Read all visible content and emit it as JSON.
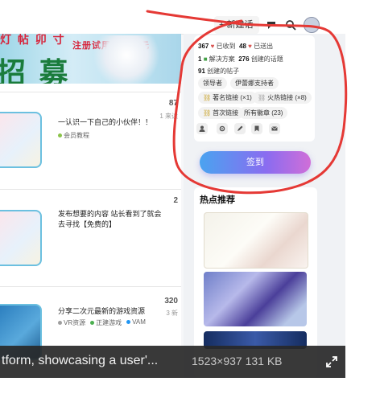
{
  "header": {
    "new_topic_label": "+ 新建话题",
    "icons": [
      "chat-icon",
      "search-icon",
      "avatar"
    ]
  },
  "banner": {
    "big_text": "招 募",
    "slogan": "注册试用仅需一元",
    "corner_text": "灯 帖 卯 寸"
  },
  "topics": [
    {
      "title": "一认识一下自己的小伙伴！！",
      "tags": [
        "会员教程"
      ],
      "tag_colors": [
        "#8bc34a"
      ],
      "count": "87",
      "count_sub": "1 来读"
    },
    {
      "title": "发布想要的内容 站长看到了就会 去寻找【免费的】",
      "tags": [],
      "tag_colors": [],
      "count": "2",
      "count_sub": ""
    },
    {
      "title": "分享二次元最新的游戏资源",
      "tags": [
        "VR资源",
        "正建游戏",
        "VAM"
      ],
      "tag_colors": [
        "#9e9e9e",
        "#4caf50",
        "#2196f3"
      ],
      "count": "320",
      "count_sub": "3 新"
    }
  ],
  "profile": {
    "received": "367",
    "received_label": "已收到",
    "sent": "48",
    "sent_label": "已送出",
    "solutions": "1",
    "solutions_label": "解决方案",
    "topics_created": "276",
    "topics_created_label": "创建的话题",
    "posts_created": "91",
    "posts_created_label": "创建的帖子",
    "badges": [
      "领导者",
      "伊蕾娜支持者"
    ],
    "links": [
      "著名链接 (×1)",
      "火热链接 (×8)",
      "首次链接"
    ],
    "all_badges": "所有徽章 (23)",
    "icons": [
      "user-icon",
      "gear-icon",
      "pencil-icon",
      "bookmark-icon",
      "mail-icon"
    ]
  },
  "checkin_label": "签到",
  "hot": {
    "title": "热点推荐"
  },
  "caption": {
    "text": "tform, showcasing a user'...",
    "meta": "1523×937 131 KB"
  },
  "colors": {
    "annotation_red": "#e53935",
    "checkin_start": "#4aa3f0",
    "checkin_end": "#d06ed8"
  }
}
